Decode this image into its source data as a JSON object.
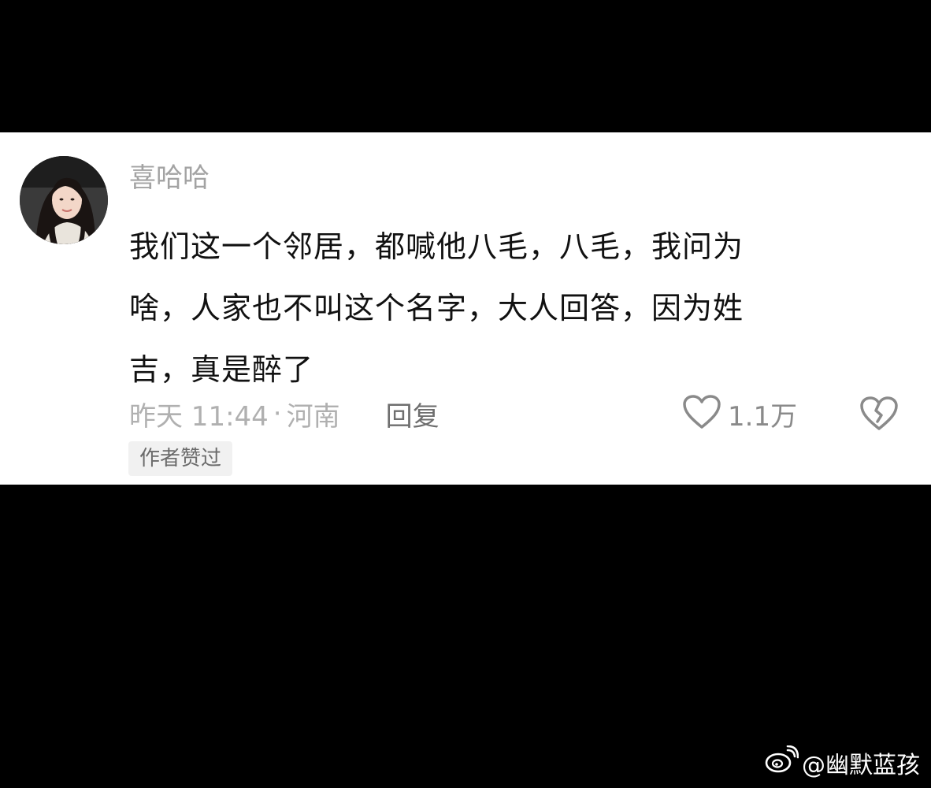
{
  "comment": {
    "username": "喜哈哈",
    "text_lines": [
      "我们这一个邻居，都喊他八毛，八毛，我问为",
      "啥，人家也不叫这个名字，大人回答，因为姓",
      "吉，真是醉了"
    ],
    "time": "昨天 11:44",
    "separator": "·",
    "location": "河南",
    "reply_label": "回复",
    "like_count": "1.1万",
    "author_liked_badge": "作者赞过",
    "like_icon": "heart-outline-icon",
    "dislike_icon": "broken-heart-icon"
  },
  "watermark": {
    "icon": "weibo-logo-icon",
    "text": "@幽默蓝孩"
  },
  "colors": {
    "background": "#000000",
    "card": "#ffffff",
    "username": "#a3a3a3",
    "body_text": "#111111",
    "meta": "#b0b0b0",
    "badge_bg": "#f1f1f1"
  }
}
